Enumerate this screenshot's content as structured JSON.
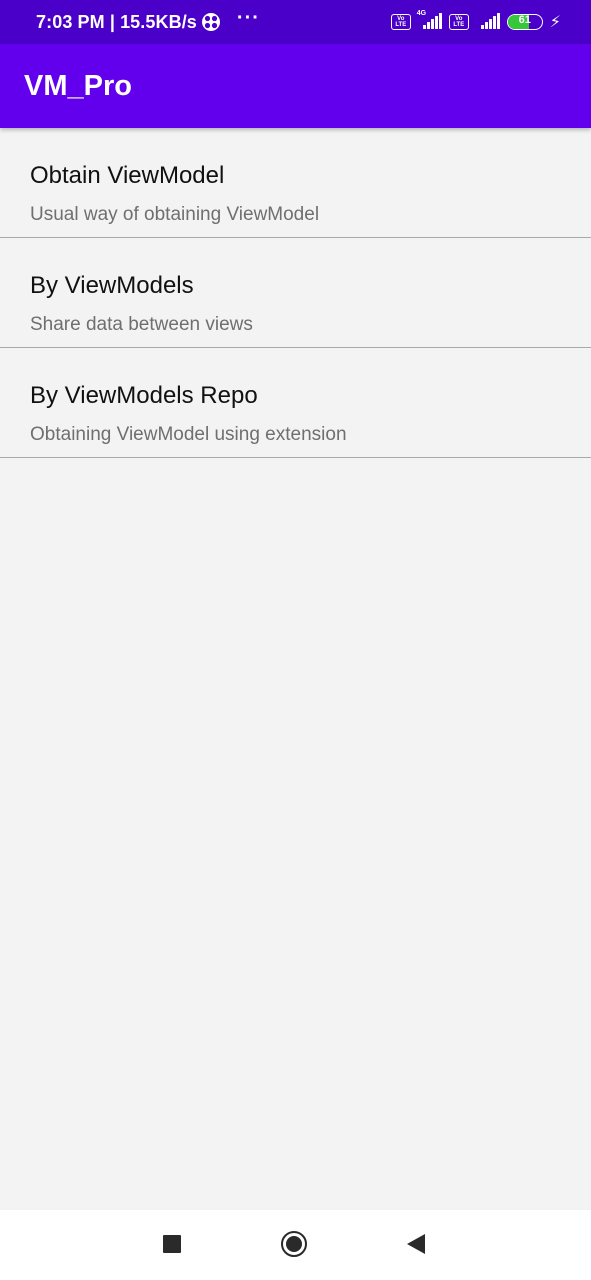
{
  "status_bar": {
    "time_and_speed": "7:03 PM | 15.5KB/s",
    "overflow_dots": "···",
    "volte_label_1": "Vo LTE",
    "network_type": "4G",
    "volte_label_2": "Vo LTE",
    "battery_percent": "61",
    "battery_level": 0.61,
    "battery_color": "#36c73b",
    "charging_icon": "bolt-icon",
    "fan_icon": "fan-icon"
  },
  "app_bar": {
    "title": "VM_Pro",
    "color": "#6200ee",
    "status_color": "#4a00c8"
  },
  "list": {
    "items": [
      {
        "title": "Obtain ViewModel",
        "subtitle": "Usual way of obtaining ViewModel"
      },
      {
        "title": "By ViewModels",
        "subtitle": "Share data between views"
      },
      {
        "title": "By ViewModels Repo",
        "subtitle": "Obtaining ViewModel using extension"
      }
    ]
  },
  "nav_bar": {
    "recents_icon": "square-icon",
    "home_icon": "circle-icon",
    "back_icon": "triangle-back-icon"
  }
}
